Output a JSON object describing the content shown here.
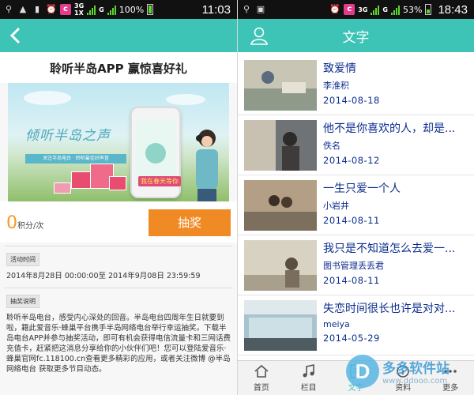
{
  "left_status": {
    "net": "3G",
    "net2": "1X",
    "carrier": "G",
    "battery": "100%",
    "time": "11:03"
  },
  "right_status": {
    "net": "3G",
    "carrier": "G",
    "battery": "53%",
    "time": "18:43"
  },
  "left": {
    "promo_title": "聆听半岛APP 赢惊喜好礼",
    "banner": {
      "slogan": "倾听半岛之声",
      "line": "关注半岛电台 · 聆听最佳好声音",
      "phone_tag": "我在春天等你"
    },
    "points_value": "0",
    "points_unit": "积分/次",
    "draw_label": "抽奖",
    "section_time_label": "活动时间",
    "activity_time": "2014年8月28日 00:00:00至 2014年9月08日 23:59:59",
    "section_desc_label": "抽奖说明",
    "description": "聆听半岛电台，感受内心深处的回音。半岛电台四周年生日就要到啦，籍此爱音乐·蜂巢平台携手半岛网络电台举行幸运抽奖。下载半岛电台APP并参与抽奖活动，即可有机会获得电信流量卡和三网话费充值卡，赶紧把这消息分享给你的小伙伴们吧！您可以登陆爱音乐·蜂巢官网fc.118100.cn查看更多精彩的应用，或者关注微博 @半岛网络电台 获取更多节目动态。"
  },
  "right": {
    "title": "文字",
    "items": [
      {
        "title": "致爱情",
        "author": "李淮积",
        "date": "2014-08-18"
      },
      {
        "title": "他不是你喜欢的人，却是...",
        "author": "佚名",
        "date": "2014-08-12"
      },
      {
        "title": "一生只爱一个人",
        "author": "小岩井",
        "date": "2014-08-11"
      },
      {
        "title": "我只是不知道怎么去爱一...",
        "author": "图书管理丢丢君",
        "date": "2014-08-11"
      },
      {
        "title": "失恋时间很长也许是对对...",
        "author": "meiya",
        "date": "2014-05-29"
      }
    ],
    "nav": [
      {
        "label": "首页"
      },
      {
        "label": "栏目"
      },
      {
        "label": "文字"
      },
      {
        "label": "资料"
      },
      {
        "label": "更多"
      }
    ]
  },
  "watermark": {
    "name": "多多软件站",
    "url": "www.ddooo.com"
  },
  "colors": {
    "accent": "#3ec3b7",
    "orange": "#f08a24",
    "link_blue": "#0b2c8e"
  }
}
